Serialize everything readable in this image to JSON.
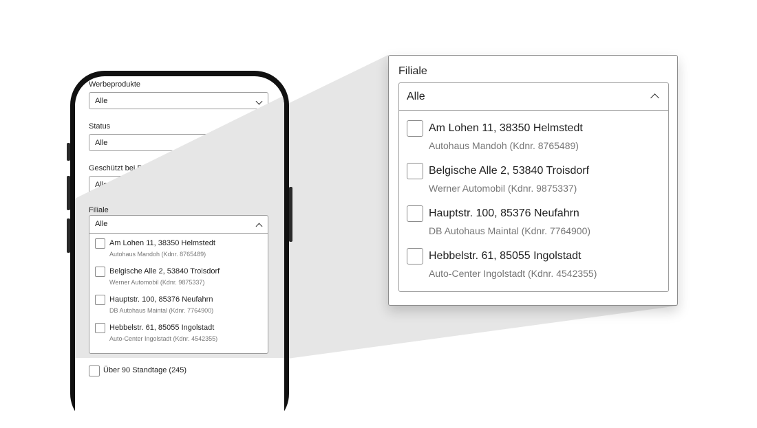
{
  "phone_screen": {
    "werbeprodukte": {
      "label": "Werbeprodukte",
      "value": "Alle"
    },
    "status": {
      "label": "Status",
      "value": "Alle"
    },
    "geschuetzt": {
      "label": "Geschützt bei Datenimport",
      "value": "Alle"
    },
    "filiale": {
      "label": "Filiale",
      "value": "Alle",
      "options": [
        {
          "address": "Am Lohen 11, 38350 Helmstedt",
          "dealer": "Autohaus Mandoh (Kdnr. 8765489)"
        },
        {
          "address": "Belgische Alle 2, 53840 Troisdorf",
          "dealer": "Werner Automobil (Kdnr. 9875337)"
        },
        {
          "address": "Hauptstr. 100, 85376 Neufahrn",
          "dealer": "DB Autohaus Maintal (Kdnr. 7764900)"
        },
        {
          "address": "Hebbelstr. 61, 85055 Ingolstadt",
          "dealer": "Auto-Center Ingolstadt (Kdnr. 4542355)"
        }
      ]
    },
    "standtage_checkbox": {
      "label": "Über 90 Standtage (245)"
    }
  },
  "zoom_panel": {
    "label": "Filiale",
    "value": "Alle",
    "options": [
      {
        "address": "Am Lohen 11, 38350 Helmstedt",
        "dealer": "Autohaus Mandoh (Kdnr. 8765489)"
      },
      {
        "address": "Belgische Alle 2, 53840 Troisdorf",
        "dealer": "Werner Automobil (Kdnr. 9875337)"
      },
      {
        "address": "Hauptstr. 100, 85376 Neufahrn",
        "dealer": "DB Autohaus Maintal (Kdnr. 7764900)"
      },
      {
        "address": "Hebbelstr. 61, 85055 Ingolstadt",
        "dealer": "Auto-Center Ingolstadt (Kdnr. 4542355)"
      }
    ]
  },
  "colors": {
    "highlight": "#e6e6e6",
    "border": "#9c9c9c",
    "secondary_text": "#777777"
  }
}
